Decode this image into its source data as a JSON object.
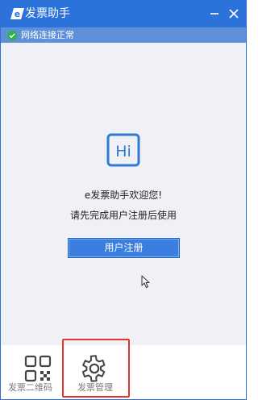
{
  "window": {
    "title": "发票助手",
    "logo_letter": "e",
    "logo_icon": "e-invoice-logo-icon",
    "minimize_icon": "minimize-icon",
    "close_icon": "close-icon"
  },
  "status": {
    "text": "网络连接正常",
    "icon": "check-circle-icon",
    "color": "#2fb14a"
  },
  "main": {
    "logo_text": "Hi",
    "welcome_text": "e发票助手欢迎您!",
    "hint_text": "请先完成用户注册后使用",
    "register_label": "用户注册"
  },
  "bottom_nav": {
    "items": [
      {
        "label": "发票二维码",
        "icon": "qr-code-icon"
      },
      {
        "label": "发票管理",
        "icon": "gear-icon"
      }
    ]
  },
  "colors": {
    "titlebar": "#2b72db",
    "statusbar": "#5e8fd9",
    "accent": "#3a7ee0",
    "highlight": "#e8342e"
  }
}
